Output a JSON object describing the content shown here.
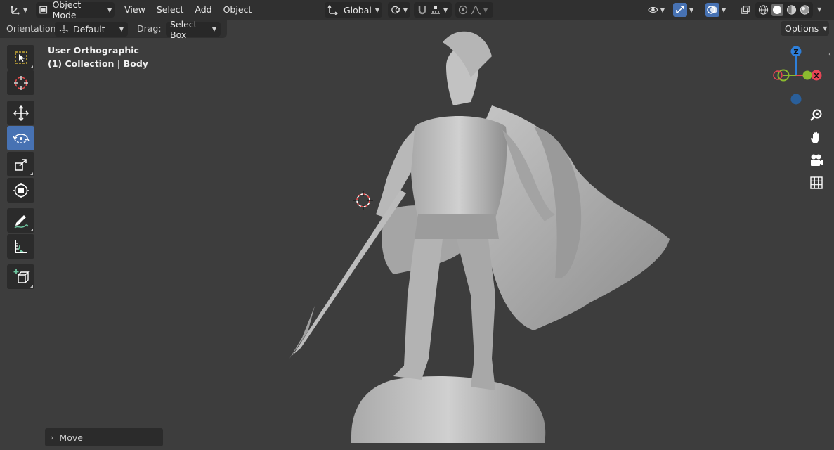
{
  "header": {
    "mode_label": "Object Mode",
    "menus": [
      "View",
      "Select",
      "Add",
      "Object"
    ],
    "transform_orientation": "Global"
  },
  "tool_settings": {
    "orientation_label": "Orientation:",
    "orientation_value": "Default",
    "drag_label": "Drag:",
    "drag_value": "Select Box",
    "options_label": "Options"
  },
  "viewport": {
    "view_name": "User Orthographic",
    "collection_info": "(1) Collection | Body"
  },
  "gizmo": {
    "z_label": "Z",
    "x_label": "X",
    "colors": {
      "x": "#e64555",
      "y": "#8bba2f",
      "z": "#2e7fd9"
    }
  },
  "tools": [
    {
      "name": "select-box-tool",
      "active": false
    },
    {
      "name": "cursor-tool",
      "active": false
    },
    {
      "name": "move-tool",
      "active": false
    },
    {
      "name": "rotate-tool",
      "active": true
    },
    {
      "name": "scale-tool",
      "active": false
    },
    {
      "name": "transform-tool",
      "active": false
    },
    {
      "name": "annotate-tool",
      "active": false
    },
    {
      "name": "measure-tool",
      "active": false
    },
    {
      "name": "add-cube-tool",
      "active": false
    }
  ],
  "last_operator": {
    "label": "Move"
  },
  "accent_color": "#4772b3"
}
